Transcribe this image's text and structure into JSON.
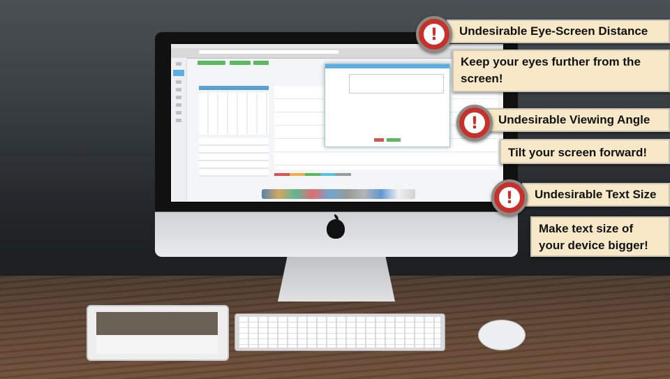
{
  "alerts": [
    {
      "icon": "exclamation-icon",
      "mark": "!",
      "title": "Undesirable Eye-Screen Distance",
      "message": "Keep your eyes further from the screen!"
    },
    {
      "icon": "exclamation-icon",
      "mark": "!",
      "title": "Undesirable Viewing Angle",
      "message": "Tilt your screen forward!"
    },
    {
      "icon": "exclamation-icon",
      "mark": "!",
      "title": "Undesirable Text Size",
      "message": "Make text size of your device bigger!"
    }
  ],
  "colors": {
    "alert_red": "#c8312b",
    "callout_bg": "#f7e9c7"
  }
}
